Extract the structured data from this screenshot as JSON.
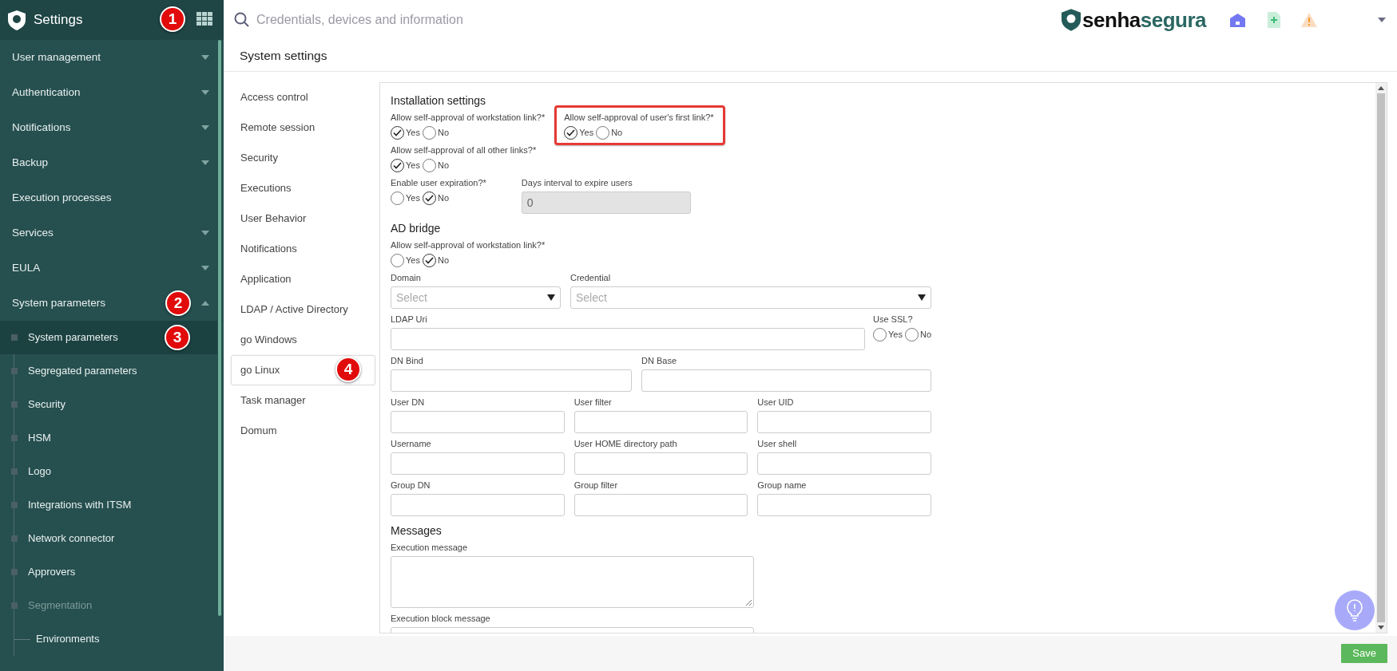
{
  "sidebar": {
    "title": "Settings",
    "apps_badge": "1",
    "items": [
      {
        "label": "User management",
        "kind": "group",
        "expanded": false
      },
      {
        "label": "Authentication",
        "kind": "group",
        "expanded": false
      },
      {
        "label": "Notifications",
        "kind": "group",
        "expanded": false
      },
      {
        "label": "Backup",
        "kind": "group",
        "expanded": false
      },
      {
        "label": "Execution processes",
        "kind": "link"
      },
      {
        "label": "Services",
        "kind": "group",
        "expanded": false
      },
      {
        "label": "EULA",
        "kind": "group",
        "expanded": false
      },
      {
        "label": "System parameters",
        "kind": "group",
        "expanded": true,
        "badge": "2",
        "children": [
          {
            "label": "System parameters",
            "selected": true,
            "disabled": false,
            "badge": "3"
          },
          {
            "label": "Segregated parameters",
            "selected": false,
            "disabled": false
          },
          {
            "label": "Security",
            "selected": false,
            "disabled": false
          },
          {
            "label": "HSM",
            "selected": false,
            "disabled": false
          },
          {
            "label": "Logo",
            "selected": false,
            "disabled": false
          },
          {
            "label": "Integrations with ITSM",
            "selected": false,
            "disabled": false
          },
          {
            "label": "Network connector",
            "selected": false,
            "disabled": false
          },
          {
            "label": "Approvers",
            "selected": false,
            "disabled": false
          },
          {
            "label": "Segmentation",
            "selected": false,
            "disabled": true,
            "children": [
              {
                "label": "Environments",
                "selected": false,
                "disabled": false
              }
            ]
          }
        ]
      }
    ]
  },
  "topbar": {
    "search": {
      "placeholder": "Credentials, devices and information"
    },
    "brand": {
      "part1": "senha",
      "part2": "segura"
    }
  },
  "page": {
    "title": "System settings"
  },
  "subnav": [
    {
      "label": "Access control",
      "selected": false
    },
    {
      "label": "Remote session",
      "selected": false
    },
    {
      "label": "Security",
      "selected": false
    },
    {
      "label": "Executions",
      "selected": false
    },
    {
      "label": "User Behavior",
      "selected": false
    },
    {
      "label": "Notifications",
      "selected": false
    },
    {
      "label": "Application",
      "selected": false
    },
    {
      "label": "LDAP / Active Directory",
      "selected": false
    },
    {
      "label": "go Windows",
      "selected": false
    },
    {
      "label": "go Linux",
      "selected": true,
      "badge": "4"
    },
    {
      "label": "Task manager",
      "selected": false
    },
    {
      "label": "Domum",
      "selected": false
    }
  ],
  "form": {
    "sections": [
      {
        "title": "Installation settings",
        "rows": [
          [
            {
              "kind": "radio",
              "label": "Allow self-approval of workstation link?*",
              "highlighted": false,
              "options": [
                {
                  "label": "Yes",
                  "selected": true
                },
                {
                  "label": "No",
                  "selected": false
                }
              ]
            },
            {
              "kind": "radio",
              "label": "Allow self-approval of user's first link?*",
              "highlighted": true,
              "options": [
                {
                  "label": "Yes",
                  "selected": true
                },
                {
                  "label": "No",
                  "selected": false
                }
              ]
            }
          ],
          [
            {
              "kind": "radio",
              "label": "Allow self-approval of all other links?*",
              "highlighted": false,
              "options": [
                {
                  "label": "Yes",
                  "selected": true
                },
                {
                  "label": "No",
                  "selected": false
                }
              ]
            }
          ],
          [
            {
              "kind": "radio",
              "label": "Enable user expiration?*",
              "highlighted": false,
              "options": [
                {
                  "label": "Yes",
                  "selected": false
                },
                {
                  "label": "No",
                  "selected": true
                }
              ]
            },
            {
              "kind": "text",
              "label": "Days interval to expire users",
              "value": "0",
              "disabled": true
            }
          ]
        ]
      },
      {
        "title": "AD bridge",
        "rows": [
          [
            {
              "kind": "radio",
              "label": "Allow self-approval of workstation link?*",
              "highlighted": false,
              "options": [
                {
                  "label": "Yes",
                  "selected": false
                },
                {
                  "label": "No",
                  "selected": true
                }
              ]
            }
          ],
          [
            {
              "kind": "select",
              "label": "Domain",
              "placeholder": "Select"
            },
            {
              "kind": "select",
              "label": "Credential",
              "placeholder": "Select"
            }
          ],
          [
            {
              "kind": "text",
              "label": "LDAP Uri",
              "disabled": false
            },
            {
              "kind": "radio",
              "label": "Use SSL?",
              "highlighted": false,
              "options": [
                {
                  "label": "Yes",
                  "selected": false
                },
                {
                  "label": "No",
                  "selected": false
                }
              ]
            }
          ],
          [
            {
              "kind": "text",
              "label": "DN Bind",
              "disabled": false
            },
            {
              "kind": "text",
              "label": "DN Base",
              "disabled": false
            }
          ],
          [
            {
              "kind": "text",
              "label": "User DN",
              "disabled": false
            },
            {
              "kind": "text",
              "label": "User filter",
              "disabled": false
            },
            {
              "kind": "text",
              "label": "User UID",
              "disabled": false
            }
          ],
          [
            {
              "kind": "text",
              "label": "Username",
              "disabled": false
            },
            {
              "kind": "text",
              "label": "User HOME directory path",
              "disabled": false
            },
            {
              "kind": "text",
              "label": "User shell",
              "disabled": false
            }
          ],
          [
            {
              "kind": "text",
              "label": "Group DN",
              "disabled": false
            },
            {
              "kind": "text",
              "label": "Group filter",
              "disabled": false
            },
            {
              "kind": "text",
              "label": "Group name",
              "disabled": false
            }
          ]
        ]
      },
      {
        "title": "Messages",
        "rows": [
          [
            {
              "kind": "textarea",
              "label": "Execution message"
            }
          ],
          [
            {
              "kind": "textarea",
              "label": "Execution block message"
            }
          ]
        ]
      }
    ]
  },
  "footer": {
    "save": "Save"
  }
}
